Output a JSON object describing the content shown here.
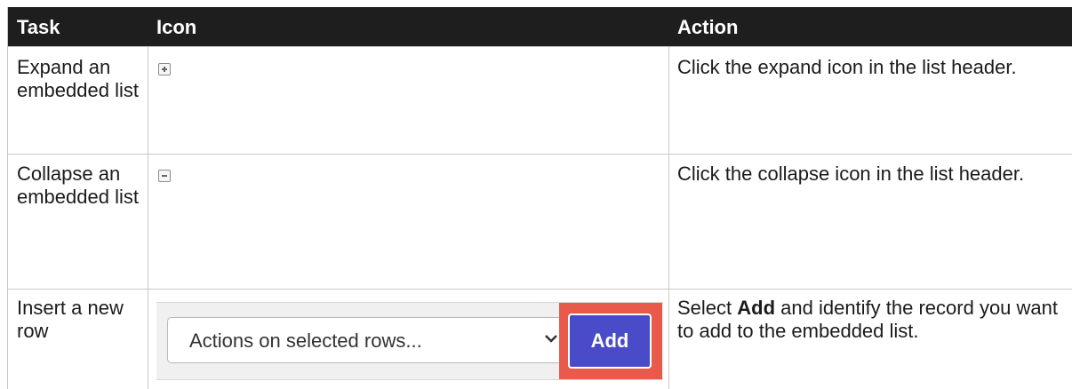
{
  "header": {
    "task": "Task",
    "icon": "Icon",
    "action": "Action"
  },
  "rows": [
    {
      "task": "Expand an embedded list",
      "icon": "plus-box-icon",
      "action": "Click the expand icon in the list header."
    },
    {
      "task": "Collapse an embedded list",
      "icon": "minus-box-icon",
      "action": "Click the collapse icon in the list header."
    },
    {
      "task": "Insert a new row",
      "icon": "actions-widget",
      "action_prefix": "Select ",
      "action_bold": "Add",
      "action_suffix": " and identify the record you want to add to the embedded list."
    }
  ],
  "widget": {
    "select_value": "Actions on selected rows...",
    "add_label": "Add"
  },
  "colors": {
    "header_bg": "#1e1e1e",
    "add_button": "#4a4bc9",
    "highlight": "#e85a4a"
  }
}
